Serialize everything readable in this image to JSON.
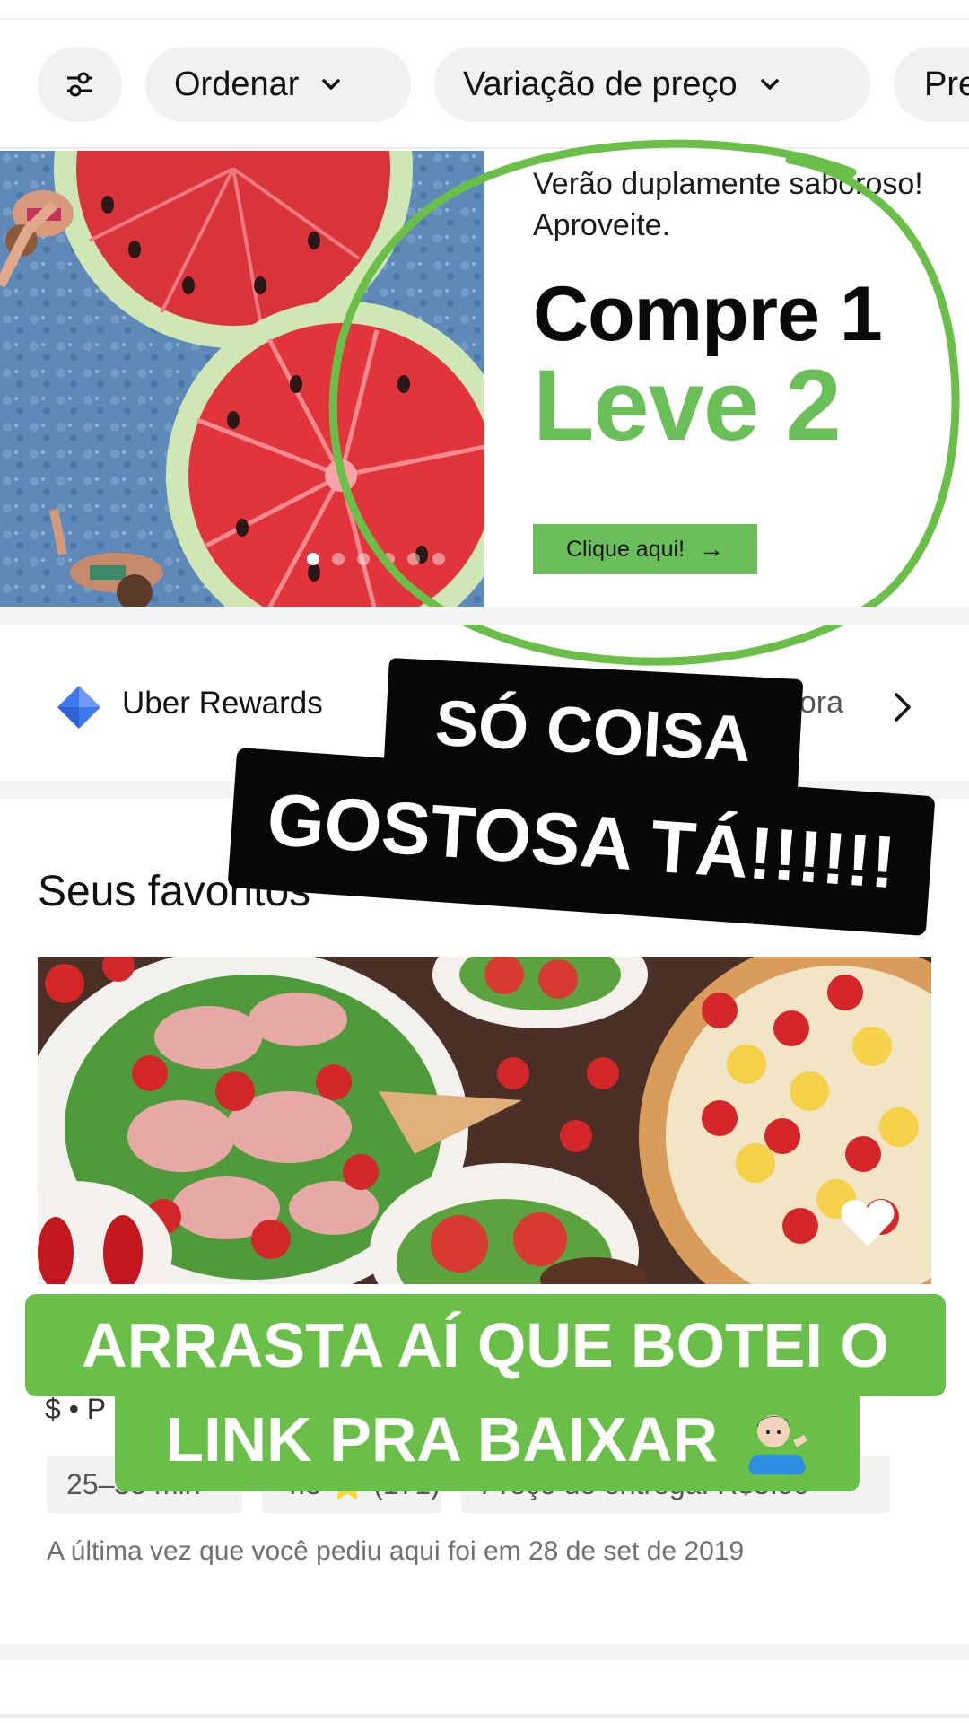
{
  "filters": {
    "filter_icon": "sliders-icon",
    "sort_label": "Ordenar",
    "price_label": "Variação de preço",
    "more_label": "Pre"
  },
  "banner": {
    "subtitle": "Verão duplamente saboroso! Aproveite.",
    "title": "Compre 1",
    "highlight": "Leve 2",
    "cta_label": "Clique aqui!",
    "cta_arrow": "→",
    "accent_color": "#6abf58",
    "active_slide": 1
  },
  "rewards": {
    "label": "Uber Rewards",
    "action_label": "Participar agora",
    "icon": "diamond-icon"
  },
  "favorites": {
    "title": "Seus favoritos",
    "restaurant": {
      "price_tier": "$ • P",
      "time": "25–35 min",
      "rating": "4.5 ⭐ (171)",
      "delivery_fee": "Preço de entrega: R$5.99",
      "last_order": "A última vez que você pediu aqui foi em 28 de set de 2019",
      "favorite_icon": "heart-icon"
    }
  },
  "stickers": {
    "black_line_1": "SÓ COISA",
    "black_line_2": "GOSTOSA TÁ!!!!!!",
    "green_line_1": "ARRASTA AÍ QUE BOTEI O",
    "green_line_2": "LINK PRA BAIXAR",
    "green_color": "#6abf48"
  }
}
